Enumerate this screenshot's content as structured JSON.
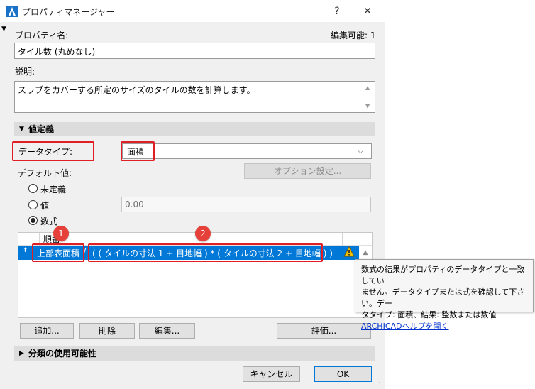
{
  "window": {
    "title": "プロパティマネージャー",
    "help_label": "?",
    "close_label": "✕"
  },
  "property_name": {
    "label": "プロパティ名:",
    "edit_count": "編集可能: 1",
    "value": "タイル数 (丸めなし)"
  },
  "description": {
    "label": "説明:",
    "value": "スラブをカバーする所定のサイズのタイルの数を計算します。"
  },
  "value_definition": {
    "section_label": "値定義",
    "data_type_label": "データタイプ:",
    "data_type_value": "面積",
    "default_value_label": "デフォルト値:",
    "option_settings_button": "オプション設定...",
    "radio_undefined": "未定義",
    "radio_value": "値",
    "value_field": "0.00",
    "radio_formula": "数式",
    "table_header": "順番",
    "formula_param": "上部表面積",
    "formula_operator": "/",
    "formula_expression": "( ( タイルの寸法 1 + 目地幅 ) * ( タイルの寸法 2 + 目地幅 ) )",
    "badge_1": "1",
    "badge_2": "2"
  },
  "buttons": {
    "add": "追加...",
    "delete": "削除",
    "edit": "編集...",
    "evaluate": "評価..."
  },
  "classification_section": "分類の使用可能性",
  "footer": {
    "cancel": "キャンセル",
    "ok": "OK"
  },
  "tooltip": {
    "line1": "数式の結果がプロパティのデータタイプと一致してい",
    "line2": "ません。データタイプまたは式を確認して下さい。デー",
    "line3": "タタイプ: 面積、結果: 整数または数値",
    "link": "ARCHICADヘルプを開く"
  },
  "colors": {
    "accent": "#0078d7",
    "highlight_red": "#e11e24",
    "badge_red": "#e5413a",
    "warning_yellow": "#f2c200",
    "link_blue": "#0033cc"
  }
}
